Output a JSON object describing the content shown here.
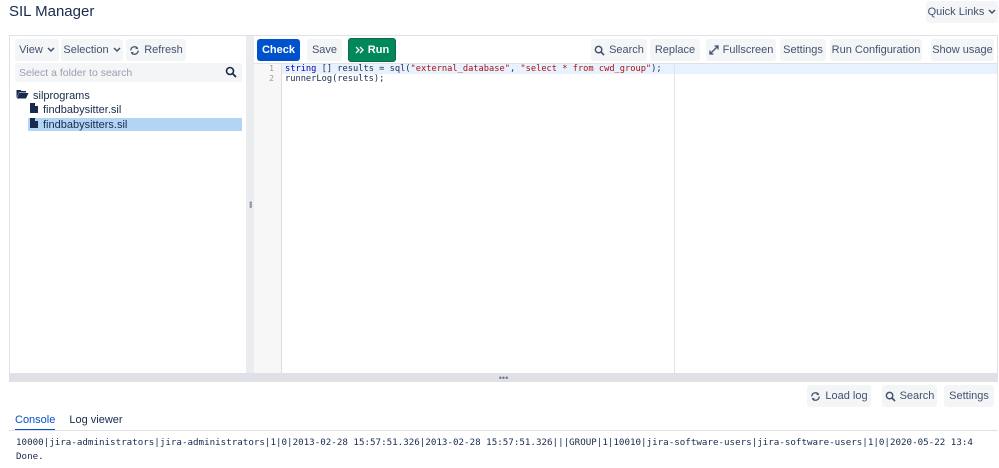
{
  "page": {
    "title": "SIL Manager"
  },
  "header": {
    "quick_links_label": "Quick Links"
  },
  "left_toolbar": {
    "view_label": "View",
    "selection_label": "Selection",
    "refresh_label": "Refresh"
  },
  "folder_search": {
    "placeholder": "Select a folder to search"
  },
  "tree": {
    "root_label": "silprograms",
    "files": [
      {
        "name": "findbabysitter.sil",
        "selected": false
      },
      {
        "name": "findbabysitters.sil",
        "selected": true
      }
    ]
  },
  "editor_toolbar": {
    "check_label": "Check",
    "save_label": "Save",
    "run_label": "Run",
    "search_label": "Search",
    "replace_label": "Replace",
    "fullscreen_label": "Fullscreen",
    "settings_label": "Settings",
    "run_configuration_label": "Run Configuration",
    "show_usage_label": "Show usage"
  },
  "editor": {
    "line_numbers": [
      "1",
      "2"
    ],
    "lines": {
      "l1_type": "string",
      "l1_rest": " [] results = sql(",
      "l1_arg1": "\"external_database\"",
      "l1_sep": ", ",
      "l1_arg2": "\"select * from cwd_group\"",
      "l1_end": ");",
      "l2": "runnerLog(results);"
    }
  },
  "bottom_toolbar": {
    "load_log_label": "Load log",
    "search_label": "Search",
    "settings_label": "Settings"
  },
  "bottom_tabs": [
    {
      "label": "Console",
      "active": true
    },
    {
      "label": "Log viewer",
      "active": false
    }
  ],
  "console": {
    "lines": [
      "10000|jira-administrators|jira-administrators|1|0|2013-02-28 15:57:51.326|2013-02-28 15:57:51.326|||GROUP|1|10010|jira-software-users|jira-software-users|1|0|2020-05-22 13:4",
      "Done."
    ]
  },
  "colors": {
    "primary": "#0052cc",
    "run_green": "#00875a",
    "selection": "#b3d4f5"
  }
}
